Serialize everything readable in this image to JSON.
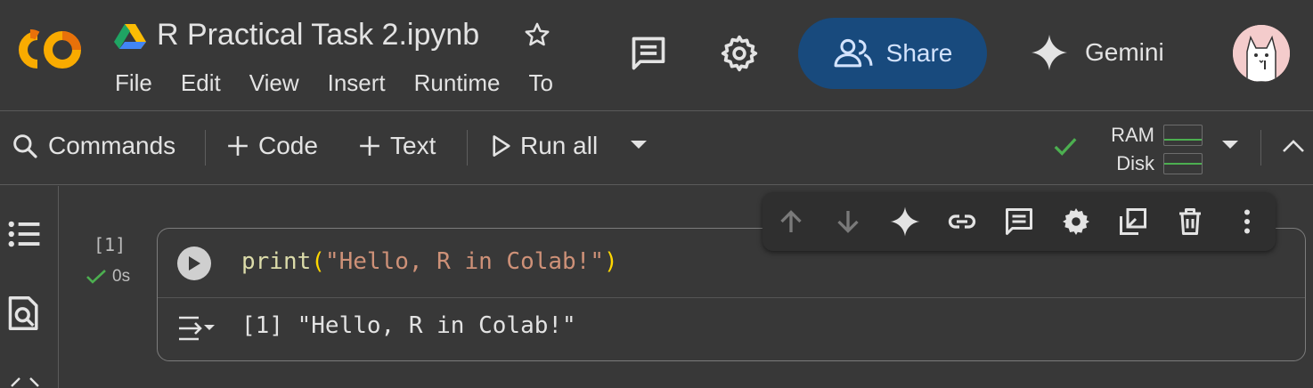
{
  "header": {
    "title": "R Practical Task 2.ipynb",
    "menu": [
      "File",
      "Edit",
      "View",
      "Insert",
      "Runtime",
      "To"
    ],
    "share_label": "Share",
    "gemini_label": "Gemini",
    "icons": [
      "colab-logo-icon",
      "drive-icon",
      "star-icon",
      "comment-icon",
      "settings-gear-icon",
      "share-people-icon",
      "gemini-sparkle-icon",
      "avatar"
    ]
  },
  "toolbar": {
    "commands_label": "Commands",
    "add_code_label": "Code",
    "add_text_label": "Text",
    "run_all_label": "Run all",
    "ram_label": "RAM",
    "disk_label": "Disk",
    "connected_status": "connected"
  },
  "cell": {
    "exec_count": "[1]",
    "exec_time": "0s",
    "code": {
      "fn": "print",
      "open_paren": "(",
      "string": "\"Hello, R in Colab!\"",
      "close_paren": ")"
    },
    "output": "[1] \"Hello, R in Colab!\""
  },
  "cell_toolbar": {
    "icons": [
      "move-up-icon",
      "move-down-icon",
      "gemini-icon",
      "link-icon",
      "comment-icon",
      "settings-icon",
      "mirror-cell-icon",
      "delete-icon",
      "more-options-icon"
    ]
  },
  "colors": {
    "background": "#383838",
    "share_bg": "#184a7d",
    "status_ok": "#4caf50",
    "code_fn": "#dcdcaa",
    "code_string": "#ce9178",
    "code_paren": "#ffd700"
  }
}
